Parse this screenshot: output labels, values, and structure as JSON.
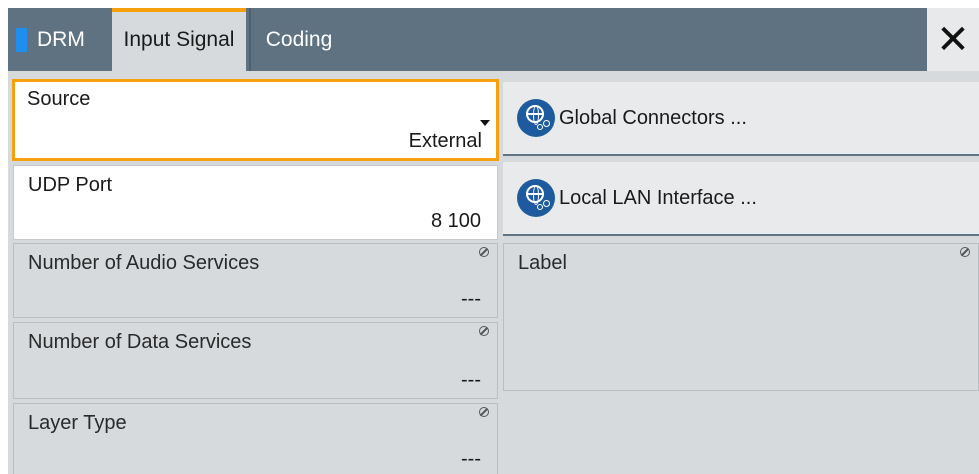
{
  "tabs": {
    "drm": "DRM",
    "input_signal": "Input Signal",
    "coding": "Coding"
  },
  "close_icon": "close-icon",
  "fields": {
    "source": {
      "label": "Source",
      "value": "External"
    },
    "udp_port": {
      "label": "UDP Port",
      "value": "8 100"
    },
    "audio_services": {
      "label": "Number of Audio Services",
      "value": "---"
    },
    "data_services": {
      "label": "Number of Data Services",
      "value": "---"
    },
    "layer_type": {
      "label": "Layer Type",
      "value": "---"
    },
    "label": {
      "label": "Label",
      "value": ""
    }
  },
  "buttons": {
    "global_connectors": "Global Connectors ...",
    "local_lan": "Local LAN Interface ..."
  },
  "colors": {
    "accent": "#f5a00c",
    "tab_bar": "#5e7282",
    "marker": "#1f8ef0",
    "globe": "#1e5b9e"
  }
}
